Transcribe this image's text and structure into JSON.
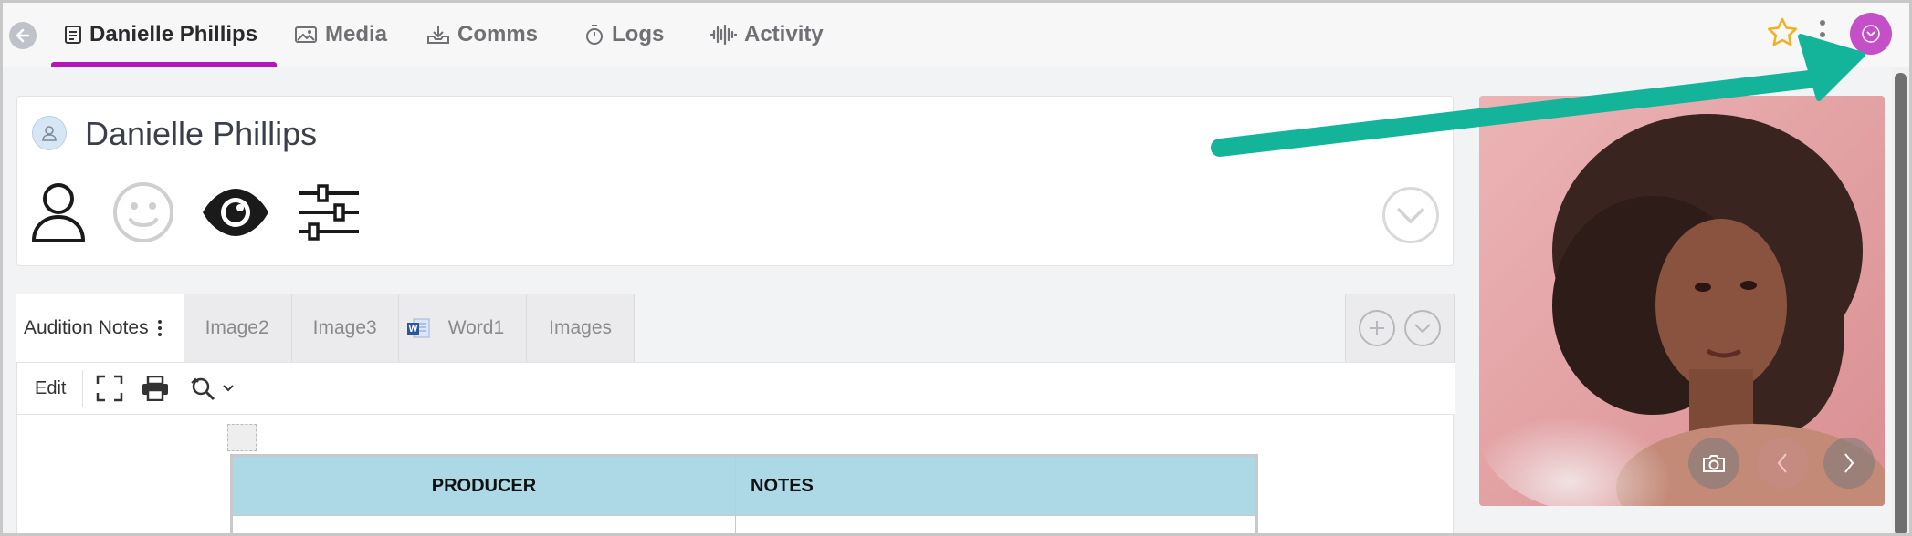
{
  "colors": {
    "accent": "#b316b8",
    "avatar_button": "#c44fc6",
    "table_header": "#add8e6",
    "annotation_arrow": "#13b49a",
    "star": "#f2b01e"
  },
  "topbar": {
    "tabs": [
      {
        "label": "Danielle Phillips",
        "icon": "document-icon",
        "active": true
      },
      {
        "label": "Media",
        "icon": "image-icon"
      },
      {
        "label": "Comms",
        "icon": "inbox-download-icon"
      },
      {
        "label": "Logs",
        "icon": "stopwatch-icon"
      },
      {
        "label": "Activity",
        "icon": "waveform-icon"
      }
    ]
  },
  "profile": {
    "name": "Danielle Phillips",
    "icons": [
      "person-outline-icon",
      "smiley-icon",
      "eye-icon",
      "sliders-icon"
    ]
  },
  "doc_tabs": [
    {
      "label": "Audition Notes",
      "active": true
    },
    {
      "label": "Image2"
    },
    {
      "label": "Image3"
    },
    {
      "label": "Word1",
      "icon": "word-doc-icon"
    },
    {
      "label": "Images"
    }
  ],
  "toolbar": {
    "edit_label": "Edit"
  },
  "table": {
    "headers": [
      "PRODUCER",
      "NOTES"
    ]
  }
}
